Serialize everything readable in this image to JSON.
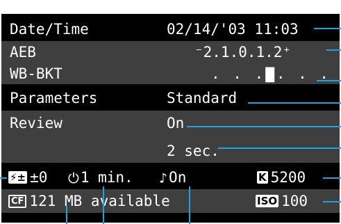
{
  "screen": {
    "date_time": {
      "label": "Date/Time",
      "value": "02/14/'03 11:03"
    },
    "aeb": {
      "label": "AEB",
      "value": "⁻2.1.0.1.2⁺"
    },
    "wb_bkt": {
      "label": "WB-BKT",
      "value": ". . .▇. . ."
    },
    "parameters": {
      "label": "Parameters",
      "value": "Standard"
    },
    "review": {
      "label": "Review",
      "value": "On",
      "time": "2 sec."
    },
    "status": {
      "flash_comp": {
        "icon": "flash-exposure-compensation-icon",
        "badge": "⚡±",
        "value": "±0"
      },
      "auto_power_off": {
        "icon": "auto-power-off-icon",
        "glyph": "ᶻᶻ",
        "value": "1 min."
      },
      "beeper": {
        "icon": "beeper-icon",
        "glyph": "∆",
        "value": "On"
      },
      "color_temp": {
        "icon": "kelvin-icon",
        "badge": "K",
        "value": "5200"
      },
      "card": {
        "icon": "cf-card-icon",
        "badge": "CF",
        "value": "121 MB available"
      },
      "iso": {
        "icon": "iso-icon",
        "badge": "ISO",
        "value": "100"
      }
    }
  },
  "colors": {
    "callout": "#19a6de",
    "screen_bg": "#000000",
    "alt_row_bg": "#3f3f3f",
    "text": "#ffffff"
  }
}
